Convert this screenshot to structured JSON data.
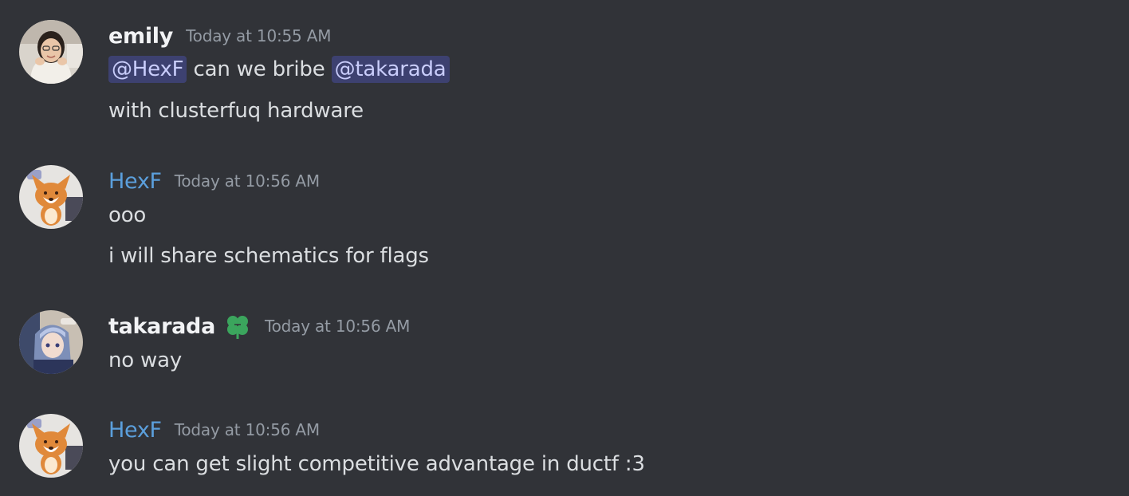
{
  "messages": [
    {
      "avatar_icon": "user-photo-avatar",
      "username": "emily",
      "timestamp": "Today at 10:55 AM",
      "lines": [
        {
          "mention1": "@HexF",
          "text1": " can we bribe ",
          "mention2": "@takarada"
        },
        {
          "text": "with clusterfuq hardware"
        }
      ]
    },
    {
      "avatar_icon": "corgi-avatar",
      "username": "HexF",
      "username_color": "#5b9fdc",
      "timestamp": "Today at 10:56 AM",
      "lines": [
        {
          "text": "ooo"
        },
        {
          "text": "i will share schematics for flags"
        }
      ]
    },
    {
      "avatar_icon": "anime-avatar",
      "username": "takarada",
      "role_icon": "green-clover-icon",
      "timestamp": "Today at 10:56 AM",
      "lines": [
        {
          "text": "no way"
        }
      ]
    },
    {
      "avatar_icon": "corgi-avatar",
      "username": "HexF",
      "username_color": "#5b9fdc",
      "timestamp": "Today at 10:56 AM",
      "lines": [
        {
          "text": "you can get slight competitive advantage in ductf :3"
        }
      ]
    }
  ],
  "colors": {
    "background": "#313338",
    "text": "#dbdee1",
    "timestamp": "#949ba4",
    "mention_bg": "rgba(88,101,242,0.3)",
    "mention_text": "#c9cdfb",
    "hexf_name": "#5b9fdc",
    "role_icon": "#3ba55d"
  }
}
